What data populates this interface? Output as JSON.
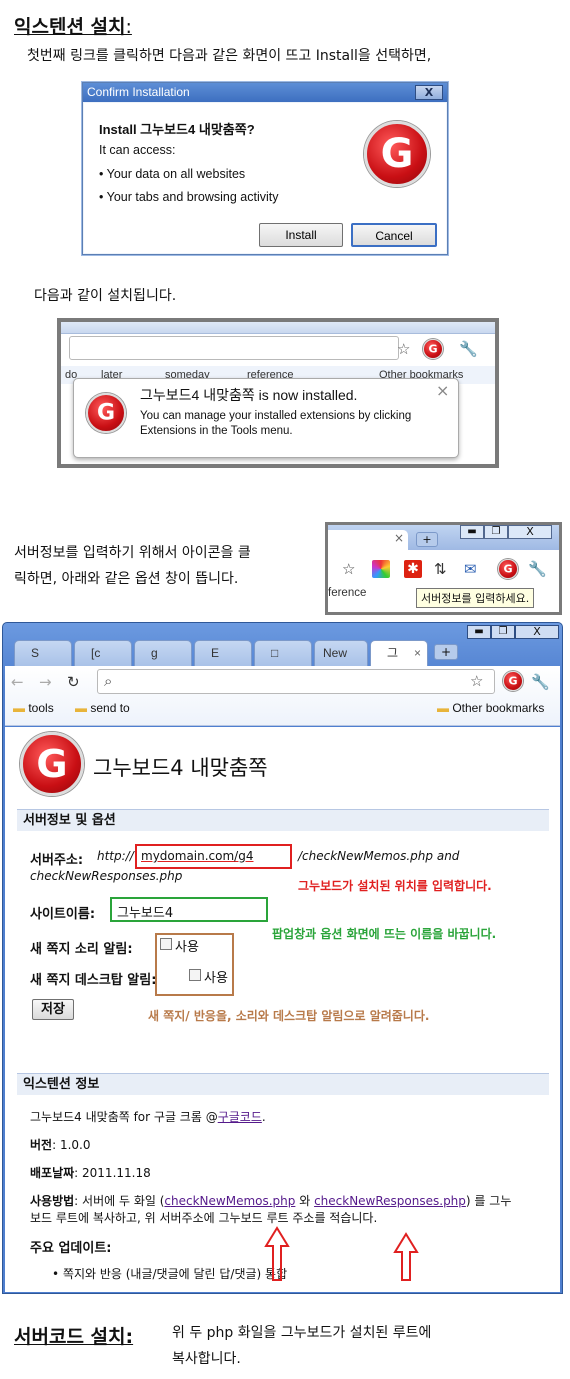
{
  "sec1": {
    "title": "익스텐션 설치",
    "colon": ":",
    "intro": "첫번째 링크를 클릭하면 다음과 같은 화면이 뜨고 Install을 선택하면,"
  },
  "dialog": {
    "title": "Confirm Installation",
    "close": "X",
    "heading": "Install 그누보드4 내맞춤쪽?",
    "access_label": "It can access:",
    "perm1": "• Your data on all websites",
    "perm2": "• Your tabs and browsing activity",
    "install": "Install",
    "cancel": "Cancel"
  },
  "installed_text": "다음과 같이 설치됩니다.",
  "bubble": {
    "bm1": "do",
    "bm2": "later",
    "bm3": "someday",
    "bm4": "reference",
    "bm5": "Other bookmarks",
    "title": "그누보드4 내맞춤쪽 is now installed.",
    "desc1": "You can manage your installed extensions by clicking",
    "desc2": "Extensions in the Tools menu.",
    "close": "×"
  },
  "click_text": {
    "line1": "서버정보를 입력하기 위해서 아이콘을 클",
    "line2": "릭하면, 아래와 같은 옵션 창이 뜹니다."
  },
  "mini": {
    "close": "×",
    "plus": "+",
    "bm": "ference",
    "tooltip": "서버정보를 입력하세요."
  },
  "browser": {
    "tabs": [
      "S",
      "[c",
      "g",
      "E",
      "□",
      "New"
    ],
    "active_tab": "그",
    "new_tab": "+",
    "bm_tools": "tools",
    "bm_send": "send to",
    "bm_other": "Other bookmarks",
    "addr": ""
  },
  "opt": {
    "title": "그누보드4 내맞춤쪽",
    "logo_letter": "G",
    "section1": "서버정보 및 옵션",
    "server_label": "서버주소",
    "server_prefix": "http://",
    "server_value": "mydomain.com/g4",
    "server_suffix": "/checkNewMemos.php and",
    "server_suffix2": "checkNewResponses.php",
    "server_note": "그누보드가 설치된 위치를 입력합니다.",
    "site_label": "사이트이름",
    "site_value": "그누보드4",
    "site_note": "팝업창과 옵션 화면에 뜨는 이름을 바꿉니다.",
    "sound_label": "새 쪽지 소리 알림",
    "desktop_label": "새 쪽지 데스크탑 알림",
    "use": "사용",
    "save": "저장",
    "alert_note": "새 쪽지/ 반응을, 소리와 데스크탑 알림으로 알려줍니다.",
    "section2": "익스텐션 정보",
    "info_text": "그누보드4 내맞춤쪽 for 구글 크롬 @",
    "info_link": "구글코드",
    "version_label": "버전",
    "version_value": "1.0.0",
    "date_label": "배포날짜",
    "date_value": "2011.11.18",
    "usage_label": "사용방법",
    "usage_a": "서버에 두 화일 (",
    "usage_link1": "checkNewMemos.php",
    "usage_mid": " 와 ",
    "usage_link2": "checkNewResponses.php",
    "usage_b": ") 를 그누",
    "usage_c": "보드 루트에 복사하고, 위 서버주소에 그누보드 루트 주소를 적습니다.",
    "update_label": "주요 업데이트",
    "update_item": "쪽지와 반응 (내글/댓글에 달린 답/댓글) 통합"
  },
  "sec2": {
    "title": "서버코드 설치:",
    "text1": "위 두 php 화일을 그누보드가 설치된 루트에",
    "text2": "복사합니다."
  },
  "colors": {
    "title_bar": "#4a7dd0",
    "red_box": "#e02020",
    "green_box": "#2aa43a",
    "brown_box": "#b87a4a"
  }
}
